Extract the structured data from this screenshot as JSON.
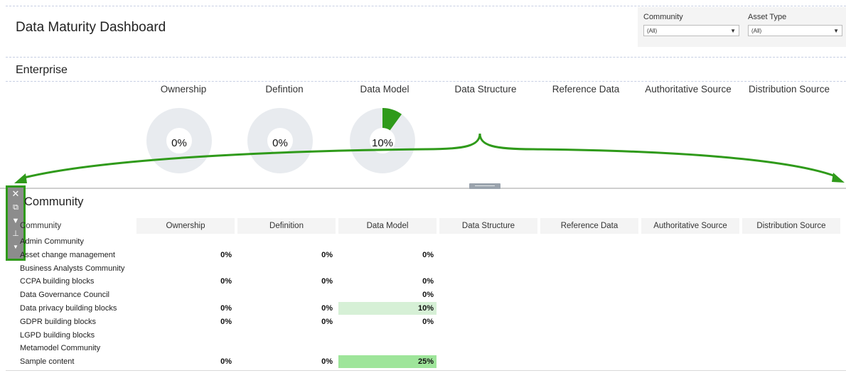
{
  "header": {
    "title": "Data Maturity Dashboard",
    "filters": [
      {
        "label": "Community",
        "value": "(All)"
      },
      {
        "label": "Asset Type",
        "value": "(All)"
      }
    ]
  },
  "enterprise": {
    "title": "Enterprise",
    "columns": [
      "Ownership",
      "Defintion",
      "Data Model",
      "Data Structure",
      "Reference Data",
      "Authoritative Source",
      "Distribution Source"
    ],
    "donuts": [
      {
        "label": "0%",
        "value": 0
      },
      {
        "label": "0%",
        "value": 0
      },
      {
        "label": "10%",
        "value": 10
      }
    ]
  },
  "colors": {
    "accent_green": "#2f9a1a",
    "donut_track": "#e8ebef",
    "highlight_light": "#d6f0d6",
    "highlight_strong": "#9ee59a"
  },
  "toolbar": {
    "icons": [
      "close-icon",
      "popout-icon",
      "filter-icon",
      "pin-icon",
      "dropdown-icon"
    ]
  },
  "community": {
    "title": "Community",
    "columns": [
      "Community",
      "Ownership",
      "Definition",
      "Data Model",
      "Data Structure",
      "Reference Data",
      "Authoritative Source",
      "Distribution Source"
    ],
    "rows": [
      {
        "name": "Admin Community",
        "ownership": "",
        "definition": "",
        "data_model": ""
      },
      {
        "name": "Asset change management",
        "ownership": "0%",
        "definition": "0%",
        "data_model": "0%"
      },
      {
        "name": "Business Analysts Community",
        "ownership": "",
        "definition": "",
        "data_model": ""
      },
      {
        "name": "CCPA building blocks",
        "ownership": "0%",
        "definition": "0%",
        "data_model": "0%"
      },
      {
        "name": "Data Governance Council",
        "ownership": "",
        "definition": "",
        "data_model": "0%"
      },
      {
        "name": "Data privacy building blocks",
        "ownership": "0%",
        "definition": "0%",
        "data_model": "10%"
      },
      {
        "name": "GDPR building blocks",
        "ownership": "0%",
        "definition": "0%",
        "data_model": "0%"
      },
      {
        "name": "LGPD building blocks",
        "ownership": "",
        "definition": "",
        "data_model": ""
      },
      {
        "name": "Metamodel Community",
        "ownership": "",
        "definition": "",
        "data_model": ""
      },
      {
        "name": "Sample content",
        "ownership": "0%",
        "definition": "0%",
        "data_model": "25%"
      }
    ]
  }
}
